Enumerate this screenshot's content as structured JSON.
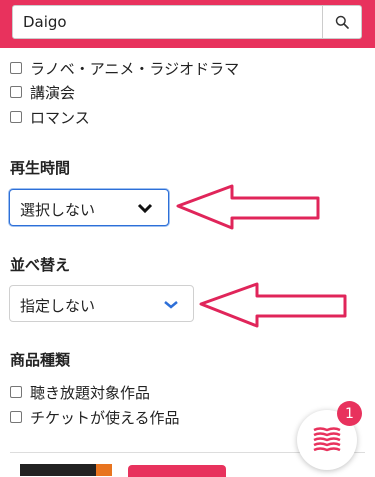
{
  "search": {
    "value": "Daigo"
  },
  "genre_checkboxes": [
    {
      "label": "ラノベ・アニメ・ラジオドラマ"
    },
    {
      "label": "講演会"
    },
    {
      "label": "ロマンス"
    }
  ],
  "playtime": {
    "title": "再生時間",
    "selected": "選択しない"
  },
  "sort": {
    "title": "並べ替え",
    "selected": "指定しない"
  },
  "product_type": {
    "title": "商品種類",
    "options": [
      {
        "label": "聴き放題対象作品"
      },
      {
        "label": "チケットが使える作品"
      }
    ]
  },
  "library_fab": {
    "badge_count": "1"
  },
  "colors": {
    "brand": "#e8325d",
    "arrow": "#e0255a",
    "focus": "#2d6fd8",
    "chevron_blue": "#2d6fd8"
  },
  "icons": [
    "search-icon",
    "chevron-down-icon",
    "books-icon"
  ]
}
